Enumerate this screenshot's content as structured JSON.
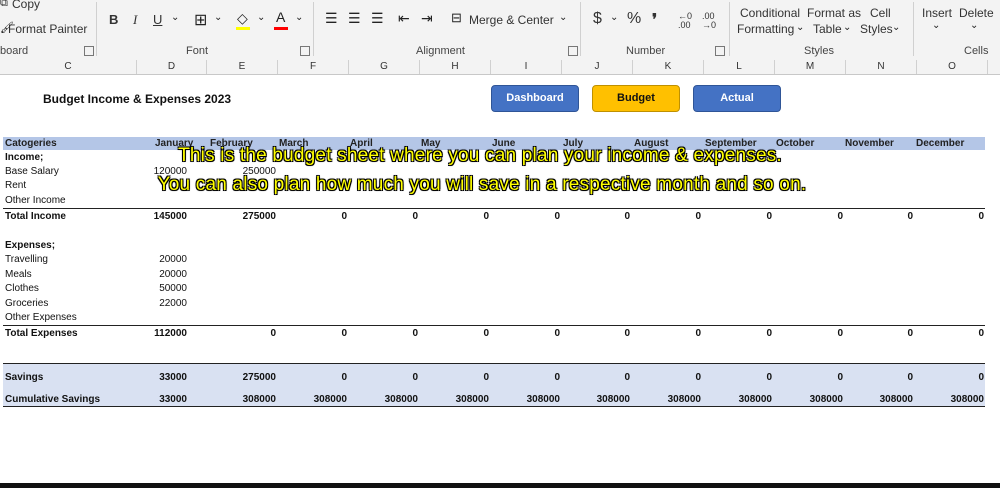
{
  "ribbon": {
    "clipboard": {
      "copy": "Copy",
      "format_painter": "Format Painter",
      "label": "board"
    },
    "font": {
      "bold": "B",
      "italic": "I",
      "underline": "U",
      "label": "Font"
    },
    "alignment": {
      "merge_center": "Merge & Center",
      "label": "Alignment"
    },
    "number": {
      "dollar": "$",
      "percent": "%",
      "comma": "❜",
      "inc_decimal": "←0 .00",
      "dec_decimal": ".00 →0",
      "label": "Number"
    },
    "styles": {
      "conditional_line1": "Conditional",
      "conditional_line2": "Formatting",
      "format_table_line1": "Format as",
      "format_table_line2": "Table",
      "cell_styles_line1": "Cell",
      "cell_styles_line2": "Styles",
      "label": "Styles"
    },
    "cells": {
      "insert": "Insert",
      "delete": "Delete",
      "label": "Cells"
    }
  },
  "columns": [
    "C",
    "D",
    "E",
    "F",
    "G",
    "H",
    "I",
    "J",
    "K",
    "L",
    "M",
    "N",
    "O"
  ],
  "sheet": {
    "title": "Budget Income & Expenses 2023",
    "buttons": {
      "dashboard": "Dashboard",
      "budget": "Budget",
      "actual": "Actual"
    },
    "header_first": "Catogeries",
    "months": [
      "January",
      "February",
      "March",
      "April",
      "May",
      "June",
      "July",
      "August",
      "September",
      "October",
      "November",
      "December"
    ],
    "income_heading": "Income;",
    "income_rows": [
      {
        "label": "Base Salary",
        "values": [
          "120000",
          "250000"
        ]
      },
      {
        "label": "Rent",
        "values": []
      },
      {
        "label": "Other Income",
        "values": []
      }
    ],
    "total_income": {
      "label": "Total Income",
      "values": [
        "145000",
        "275000",
        "0",
        "0",
        "0",
        "0",
        "0",
        "0",
        "0",
        "0",
        "0",
        "0"
      ]
    },
    "expenses_heading": "Expenses;",
    "expense_rows": [
      {
        "label": "Travelling",
        "values": [
          "20000"
        ]
      },
      {
        "label": "Meals",
        "values": [
          "20000"
        ]
      },
      {
        "label": "Clothes",
        "values": [
          "50000"
        ]
      },
      {
        "label": "Groceries",
        "values": [
          "22000"
        ]
      },
      {
        "label": "Other Expenses",
        "values": []
      }
    ],
    "total_expenses": {
      "label": "Total Expenses",
      "values": [
        "112000",
        "0",
        "0",
        "0",
        "0",
        "0",
        "0",
        "0",
        "0",
        "0",
        "0",
        "0"
      ]
    },
    "savings": {
      "label": "Savings",
      "values": [
        "33000",
        "275000",
        "0",
        "0",
        "0",
        "0",
        "0",
        "0",
        "0",
        "0",
        "0",
        "0"
      ]
    },
    "cumulative": {
      "label": "Cumulative Savings",
      "values": [
        "33000",
        "308000",
        "308000",
        "308000",
        "308000",
        "308000",
        "308000",
        "308000",
        "308000",
        "308000",
        "308000",
        "308000"
      ]
    }
  },
  "captions": {
    "line1": "This is the budget sheet where you can plan your income & expenses.",
    "line2": "You can also plan how much you will save in a respective month and so on."
  },
  "colors": {
    "header_band": "#b4c6e7",
    "savings_band": "#d9e1f2",
    "button_blue": "#4472c4",
    "button_yellow": "#ffc000",
    "caption": "#ffff00"
  }
}
